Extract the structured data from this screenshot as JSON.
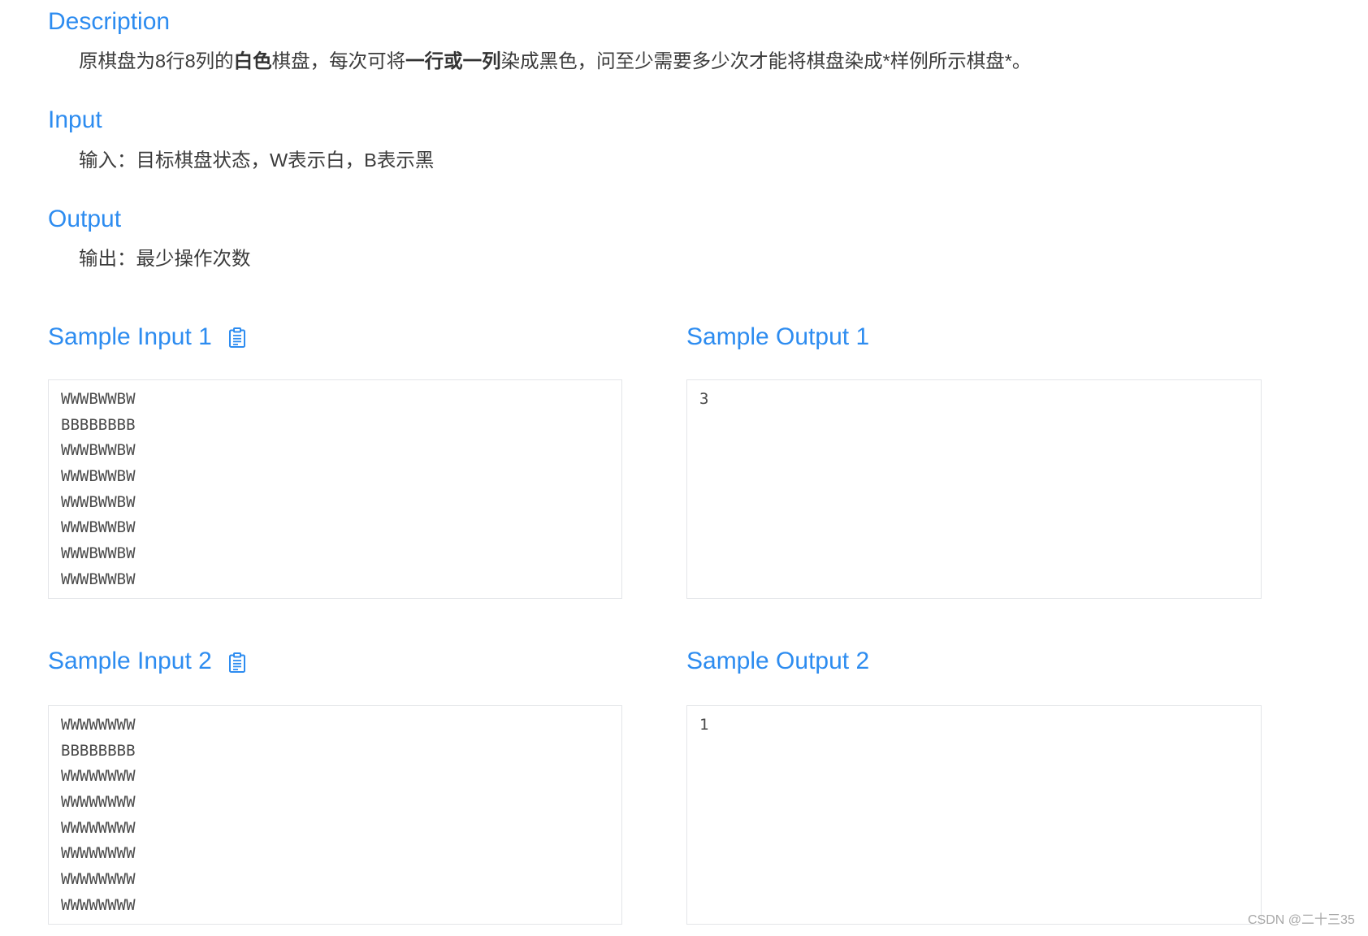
{
  "sections": {
    "description": {
      "title": "Description",
      "segments": [
        "原棋盘为8行8列的",
        "白色",
        "棋盘，每次可将",
        "一行或一列",
        "染成黑色，问至少需要多少次才能将棋盘染成*样例所示棋盘*。"
      ]
    },
    "input": {
      "title": "Input",
      "text": "输入：目标棋盘状态，W表示白，B表示黑"
    },
    "output": {
      "title": "Output",
      "text": "输出：最少操作次数"
    }
  },
  "samples": [
    {
      "input_title": "Sample Input 1",
      "output_title": "Sample Output 1",
      "input_lines": [
        "WWWBWWBW",
        "BBBBBBBB",
        "WWWBWWBW",
        "WWWBWWBW",
        "WWWBWWBW",
        "WWWBWWBW",
        "WWWBWWBW",
        "WWWBWWBW"
      ],
      "output_lines": [
        "3"
      ]
    },
    {
      "input_title": "Sample Input 2",
      "output_title": "Sample Output 2",
      "input_lines": [
        "WWWWWWWW",
        "BBBBBBBB",
        "WWWWWWWW",
        "WWWWWWWW",
        "WWWWWWWW",
        "WWWWWWWW",
        "WWWWWWWW",
        "WWWWWWWW"
      ],
      "output_lines": [
        "1"
      ]
    }
  ],
  "icons": {
    "copy": "clipboard-icon"
  },
  "colors": {
    "accent": "#2d8cf0",
    "text": "#3b3b3b",
    "border": "#e3e5e8"
  },
  "watermark": "CSDN @二十三35"
}
